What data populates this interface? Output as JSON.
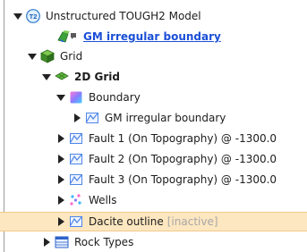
{
  "tree": {
    "model": {
      "badge": "T2",
      "label": "Unstructured TOUGH2 Model",
      "icon": "tough2-model-icon"
    },
    "gm_boundary_link": {
      "label": "GM irregular boundary",
      "icon": "geomodel-link-icon"
    },
    "grid": {
      "label": "Grid",
      "icon": "grid-cube-icon"
    },
    "grid2d": {
      "label": "2D Grid",
      "icon": "2d-grid-icon"
    },
    "boundary": {
      "label": "Boundary",
      "icon": "boundary-icon"
    },
    "boundary_child": {
      "label": "GM irregular boundary",
      "icon": "polyline-icon"
    },
    "fault1": {
      "label": "Fault 1 (On Topography) @ -1300.0",
      "icon": "polyline-icon"
    },
    "fault2": {
      "label": "Fault 2 (On Topography) @ -1300.0",
      "icon": "polyline-icon"
    },
    "fault3": {
      "label": "Fault 3 (On Topography) @ -1300.0",
      "icon": "polyline-icon"
    },
    "wells": {
      "label": "Wells",
      "icon": "wells-points-icon"
    },
    "dacite": {
      "label": "Dacite outline",
      "status": "[inactive]",
      "icon": "polyline-icon"
    },
    "rock_types": {
      "label": "Rock Types",
      "icon": "rock-types-table-icon"
    }
  },
  "colors": {
    "selection_bg": "#fde7c0",
    "link": "#1a4fd6",
    "inactive_text": "#a7a7a7"
  }
}
